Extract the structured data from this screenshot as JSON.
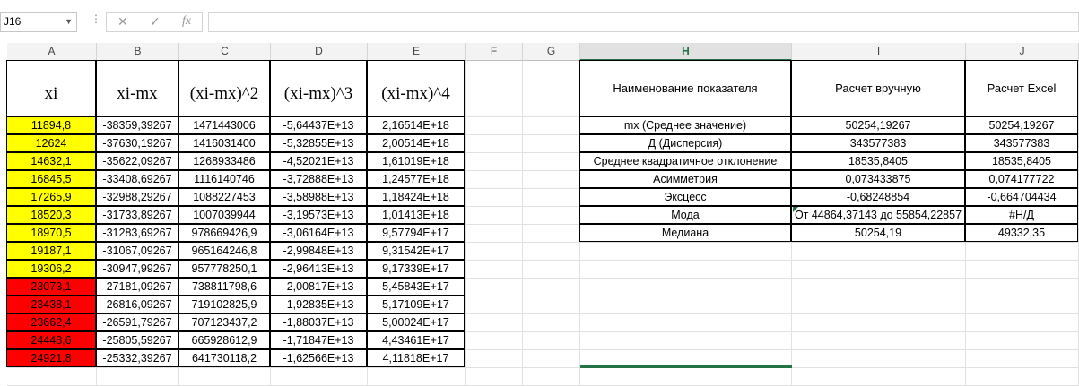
{
  "formula_bar": {
    "name_box": "J16",
    "dots": "⋮",
    "cancel_icon": "✕",
    "enter_icon": "✓",
    "fx_label": "fx",
    "formula": ""
  },
  "columns": [
    "A",
    "B",
    "C",
    "D",
    "E",
    "F",
    "G",
    "H",
    "I",
    "J"
  ],
  "selected_column": "H",
  "headers": {
    "xi": "xi",
    "dev": "xi-mx",
    "dev2": "(xi-mx)^2",
    "dev3": "(xi-mx)^3",
    "dev4": "(xi-mx)^4"
  },
  "rows": [
    {
      "a": "11894,8",
      "b": "-38359,39267",
      "c": "1471443006",
      "d": "-5,64437E+13",
      "e": "2,16514E+18",
      "fill": "yellow"
    },
    {
      "a": "12624",
      "b": "-37630,19267",
      "c": "1416031400",
      "d": "-5,32855E+13",
      "e": "2,00514E+18",
      "fill": "yellow"
    },
    {
      "a": "14632,1",
      "b": "-35622,09267",
      "c": "1268933486",
      "d": "-4,52021E+13",
      "e": "1,61019E+18",
      "fill": "yellow"
    },
    {
      "a": "16845,5",
      "b": "-33408,69267",
      "c": "1116140746",
      "d": "-3,72888E+13",
      "e": "1,24577E+18",
      "fill": "yellow"
    },
    {
      "a": "17265,9",
      "b": "-32988,29267",
      "c": "1088227453",
      "d": "-3,58988E+13",
      "e": "1,18424E+18",
      "fill": "yellow"
    },
    {
      "a": "18520,3",
      "b": "-31733,89267",
      "c": "1007039944",
      "d": "-3,19573E+13",
      "e": "1,01413E+18",
      "fill": "yellow"
    },
    {
      "a": "18970,5",
      "b": "-31283,69267",
      "c": "978669426,9",
      "d": "-3,06164E+13",
      "e": "9,57794E+17",
      "fill": "yellow"
    },
    {
      "a": "19187,1",
      "b": "-31067,09267",
      "c": "965164246,8",
      "d": "-2,99848E+13",
      "e": "9,31542E+17",
      "fill": "yellow"
    },
    {
      "a": "19306,2",
      "b": "-30947,99267",
      "c": "957778250,1",
      "d": "-2,96413E+13",
      "e": "9,17339E+17",
      "fill": "yellow"
    },
    {
      "a": "23073,1",
      "b": "-27181,09267",
      "c": "738811798,6",
      "d": "-2,00817E+13",
      "e": "5,45843E+17",
      "fill": "red"
    },
    {
      "a": "23438,1",
      "b": "-26816,09267",
      "c": "719102825,9",
      "d": "-1,92835E+13",
      "e": "5,17109E+17",
      "fill": "red"
    },
    {
      "a": "23662,4",
      "b": "-26591,79267",
      "c": "707123437,2",
      "d": "-1,88037E+13",
      "e": "5,00024E+17",
      "fill": "red"
    },
    {
      "a": "24448,6",
      "b": "-25805,59267",
      "c": "665928612,9",
      "d": "-1,71847E+13",
      "e": "4,43461E+17",
      "fill": "red"
    },
    {
      "a": "24921,8",
      "b": "-25332,39267",
      "c": "641730118,2",
      "d": "-1,62566E+13",
      "e": "4,11818E+17",
      "fill": "red"
    }
  ],
  "stats": {
    "header_name": "Наименование показателя",
    "header_manual": "Расчет вручную",
    "header_excel": "Расчет Excel",
    "items": [
      {
        "name": "mx (Среднее значение)",
        "manual": "50254,19267",
        "excel": "50254,19267"
      },
      {
        "name": "Д (Дисперсия)",
        "manual": "343577383",
        "excel": "343577383"
      },
      {
        "name": "Среднее квадратичное отклонение",
        "manual": "18535,8405",
        "excel": "18535,8405"
      },
      {
        "name": "Асимметрия",
        "manual": "0,073433875",
        "excel": "0,074177722"
      },
      {
        "name": "Эксцесс",
        "manual": "-0,68248854",
        "excel": "-0,664704434"
      },
      {
        "name": "Мода",
        "manual": "От 44864,37143 до 55854,22857",
        "excel": "#Н/Д"
      },
      {
        "name": "Медиана",
        "manual": "50254,19",
        "excel": "49332,35"
      }
    ]
  },
  "colors": {
    "yellow": "#ffff00",
    "red": "#ff0000",
    "select_green": "#217346"
  }
}
